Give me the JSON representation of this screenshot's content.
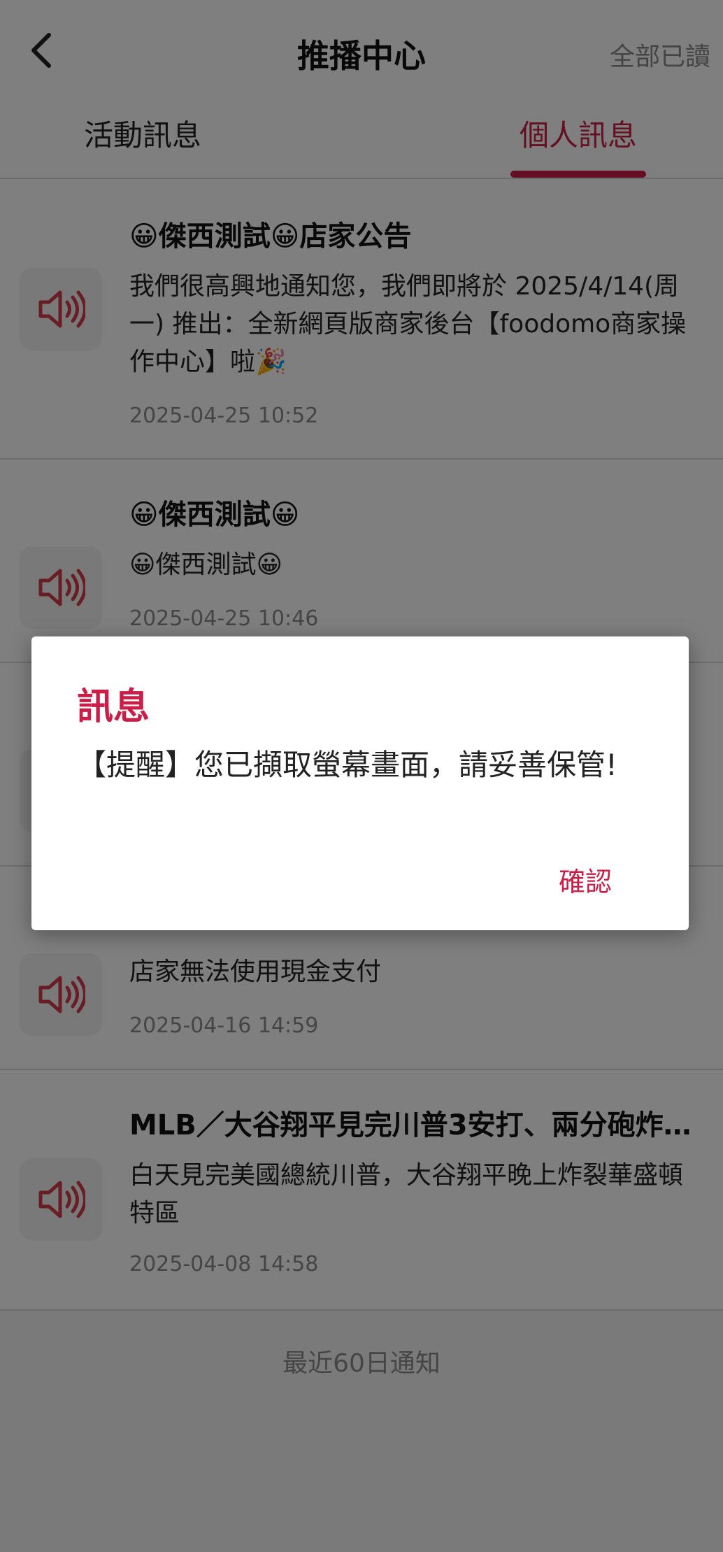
{
  "header": {
    "title": "推播中心",
    "mark_all_read": "全部已讀"
  },
  "tabs": [
    {
      "label": "活動訊息",
      "selected": false
    },
    {
      "label": "個人訊息",
      "selected": true
    }
  ],
  "accent_color": "#c81e47",
  "messages": [
    {
      "icon": "speaker-icon",
      "title": "😀傑西測試😀店家公告",
      "body": "我們很高興地通知您，我們即將於 2025/4/14(周一) 推出：全新網頁版商家後台【foodomo商家操作中心】啦🎉",
      "time": "2025-04-25 10:52"
    },
    {
      "icon": "speaker-icon",
      "title": "😀傑西測試😀",
      "body": "😀傑西測試😀",
      "time": "2025-04-25 10:46"
    },
    {
      "icon": "speaker-icon",
      "title": "",
      "body": "",
      "time": ""
    },
    {
      "icon": "speaker-icon",
      "title": "",
      "body": "店家無法使用現金支付",
      "time": "2025-04-16 14:59"
    },
    {
      "icon": "speaker-icon",
      "title": "MLB／大谷翔平見完川普3安打、兩分砲炸…",
      "body": "白天見完美國總統川普，大谷翔平晚上炸裂華盛頓特區",
      "time": "2025-04-08 14:58"
    }
  ],
  "footer": {
    "note": "最近60日通知"
  },
  "dialog": {
    "title": "訊息",
    "message": "【提醒】您已擷取螢幕畫面，請妥善保管!",
    "confirm_label": "確認"
  }
}
